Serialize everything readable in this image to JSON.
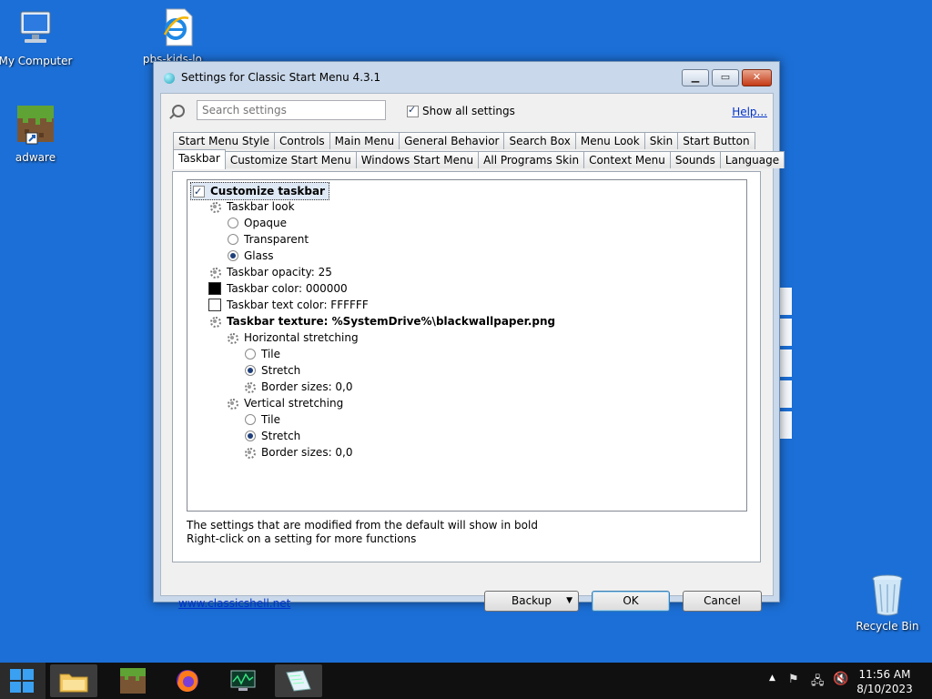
{
  "desktop": {
    "icons": [
      {
        "label": "My Computer"
      },
      {
        "label": "pbs-kids-lo..."
      },
      {
        "label": "adware"
      },
      {
        "label": "Recycle Bin"
      }
    ]
  },
  "dialog": {
    "title": "Settings for Classic Start Menu 4.3.1",
    "search_placeholder": "Search settings",
    "show_all_label": "Show all settings",
    "help_label": "Help...",
    "tabs_row1": [
      "Start Menu Style",
      "Controls",
      "Main Menu",
      "General Behavior",
      "Search Box",
      "Menu Look",
      "Skin",
      "Start Button"
    ],
    "tabs_row2": [
      "Taskbar",
      "Customize Start Menu",
      "Windows Start Menu",
      "All Programs Skin",
      "Context Menu",
      "Sounds",
      "Language"
    ],
    "active_tab": "Taskbar",
    "tree": {
      "customize_taskbar": "Customize taskbar",
      "taskbar_look": "Taskbar look",
      "opaque": "Opaque",
      "transparent": "Transparent",
      "glass": "Glass",
      "opacity": "Taskbar opacity: 25",
      "color": "Taskbar color: 000000",
      "text_color": "Taskbar text color: FFFFFF",
      "texture": "Taskbar texture: %SystemDrive%\\blackwallpaper.png",
      "horizontal": "Horizontal stretching",
      "h_tile": "Tile",
      "h_stretch": "Stretch",
      "h_border": "Border sizes: 0,0",
      "vertical": "Vertical stretching",
      "v_tile": "Tile",
      "v_stretch": "Stretch",
      "v_border": "Border sizes: 0,0"
    },
    "colors": {
      "taskbar_color": "#000000",
      "taskbar_text_color": "#FFFFFF"
    },
    "hint1": "The settings that are modified from the default will show in bold",
    "hint2": "Right-click on a setting for more functions",
    "site_link": "www.classicshell.net",
    "backup_label": "Backup",
    "ok_label": "OK",
    "cancel_label": "Cancel"
  },
  "taskbar": {
    "time": "11:56 AM",
    "date": "8/10/2023"
  }
}
